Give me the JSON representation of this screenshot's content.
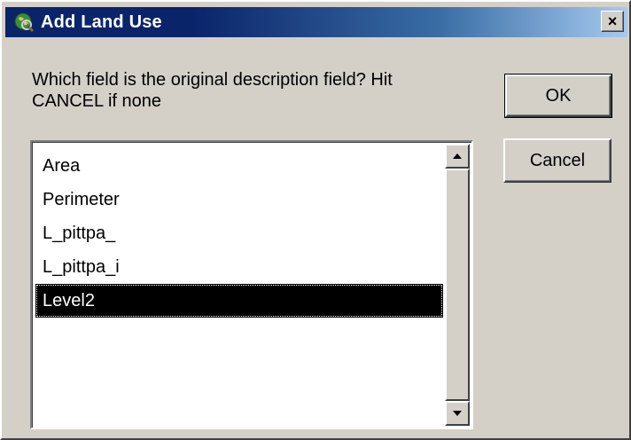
{
  "window": {
    "title": "Add Land Use",
    "icon": "globe-app-icon",
    "close_glyph": "×"
  },
  "prompt": {
    "line1": "Which field is the original description field? Hit",
    "line2": "CANCEL if none"
  },
  "buttons": {
    "ok_label": "OK",
    "cancel_label": "Cancel"
  },
  "list": {
    "items": [
      "Area",
      "Perimeter",
      "L_pittpa_",
      "L_pittpa_i",
      "Level2"
    ],
    "selected": "Level2"
  },
  "colors": {
    "titlebar_start": "#0a246a",
    "titlebar_end": "#a6caf0",
    "dialog_face": "#d4d0c8",
    "selection": "#000000"
  }
}
